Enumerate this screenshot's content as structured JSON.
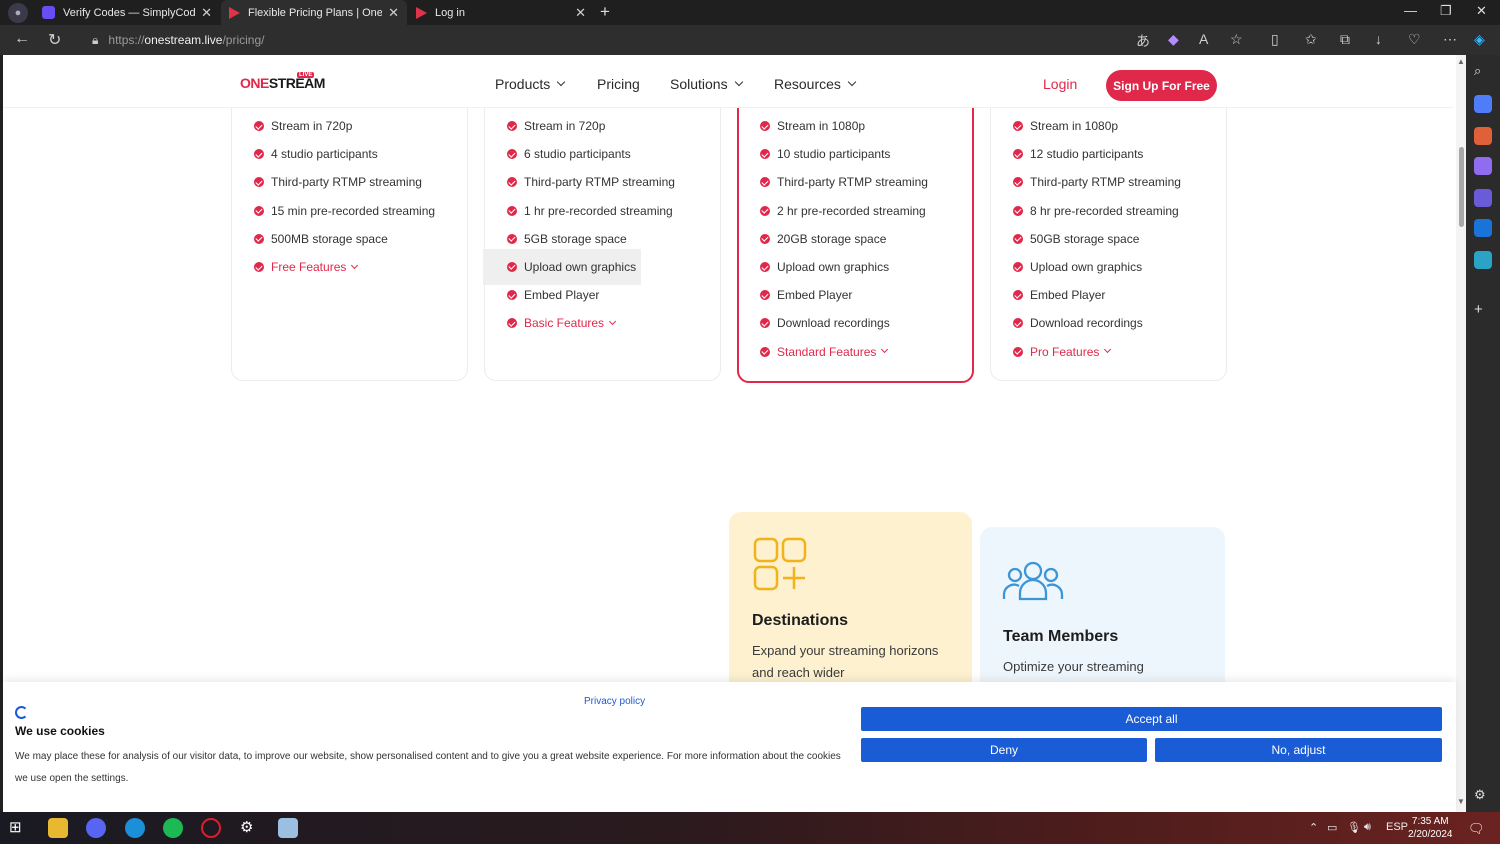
{
  "browser": {
    "tabs": [
      {
        "title": "Verify Codes — SimplyCodes",
        "active": false
      },
      {
        "title": "Flexible Pricing Plans | OneStream",
        "active": true
      },
      {
        "title": "Log in",
        "active": false
      }
    ],
    "url": {
      "protocol": "https://",
      "host": "onestream.live",
      "path": "/pricing/"
    }
  },
  "header": {
    "logo_one": "ONE",
    "logo_stream": "STREAM",
    "logo_badge": "LIVE",
    "menu": [
      {
        "label": "Products",
        "dropdown": true
      },
      {
        "label": "Pricing",
        "dropdown": false
      },
      {
        "label": "Solutions",
        "dropdown": true
      },
      {
        "label": "Resources",
        "dropdown": true
      }
    ],
    "login": "Login",
    "signup": "Sign Up For Free"
  },
  "plans": [
    {
      "items": [
        "Stream in 720p",
        "4 studio participants",
        "Third-party RTMP streaming",
        "15 min pre-recorded streaming",
        "500MB storage space"
      ],
      "more": "Free Features",
      "featured": false
    },
    {
      "items": [
        "Stream in 720p",
        "6 studio participants",
        "Third-party RTMP streaming",
        "1 hr pre-recorded streaming",
        "5GB storage space",
        "Upload own graphics",
        "Embed Player"
      ],
      "more": "Basic Features",
      "featured": false
    },
    {
      "items": [
        "Stream in 1080p",
        "10 studio participants",
        "Third-party RTMP streaming",
        "2 hr pre-recorded streaming",
        "20GB storage space",
        "Upload own graphics",
        "Embed Player",
        "Download recordings"
      ],
      "more": "Standard Features",
      "featured": true
    },
    {
      "items": [
        "Stream in 1080p",
        "12 studio participants",
        "Third-party RTMP streaming",
        "8 hr pre-recorded streaming",
        "50GB storage space",
        "Upload own graphics",
        "Embed Player",
        "Download recordings"
      ],
      "more": "Pro Features",
      "featured": false
    }
  ],
  "features": {
    "destinations": {
      "title": "Destinations",
      "desc": "Expand your streaming horizons and reach wider"
    },
    "team": {
      "title": "Team Members",
      "desc": "Optimize your streaming"
    }
  },
  "cookie": {
    "title": "We use cookies",
    "desc": "We may place these for analysis of our visitor data, to improve our website, show personalised content and to give you a great website experience. For more information about the cookies we use open the settings.",
    "privacy": "Privacy policy",
    "accept": "Accept all",
    "deny": "Deny",
    "adjust": "No, adjust"
  },
  "taskbar": {
    "lang": "ESP",
    "time": "7:35 AM",
    "date": "2/20/2024"
  },
  "colors": {
    "brand": "#e0284a",
    "cookie_button": "#1a5bd6"
  }
}
